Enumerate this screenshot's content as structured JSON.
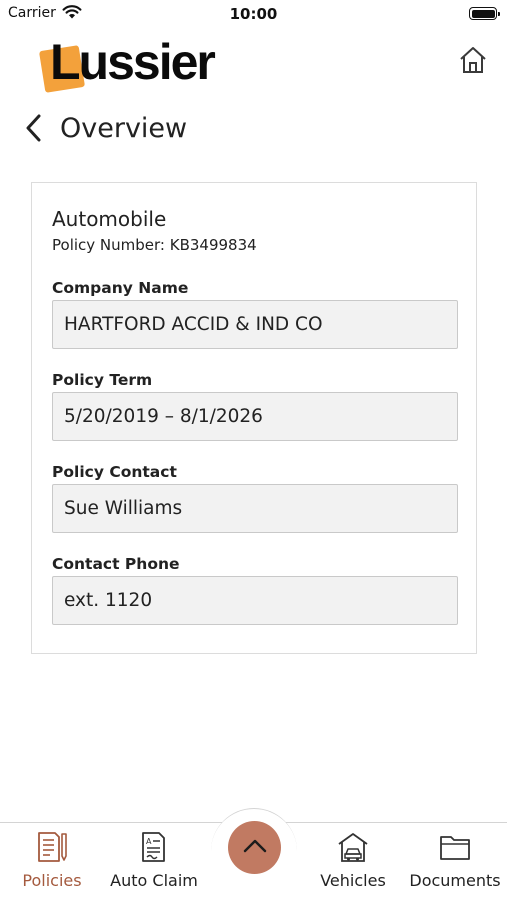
{
  "status_bar": {
    "carrier": "Carrier",
    "time": "10:00",
    "wifi_icon": "wifi-icon",
    "battery_icon": "battery-icon"
  },
  "header": {
    "logo_text": "Lussier",
    "logo_accent_color": "#f3a13b",
    "home_icon": "home-icon"
  },
  "page": {
    "back_icon": "chevron-left-icon",
    "title": "Overview"
  },
  "policy": {
    "type": "Automobile",
    "number_line": "Policy Number: KB3499834",
    "fields": [
      {
        "label": "Company Name",
        "value": "HARTFORD ACCID & IND CO"
      },
      {
        "label": "Policy Term",
        "value": "5/20/2019 – 8/1/2026"
      },
      {
        "label": "Policy Contact",
        "value": "Sue Williams"
      },
      {
        "label": "Contact Phone",
        "value": "ext. 1120"
      }
    ]
  },
  "tab_bar": {
    "accent_color": "#a45a3e",
    "fab_color": "#c17a62",
    "fab_icon": "chevron-up-icon",
    "tabs": [
      {
        "label": "Policies",
        "icon": "policy-document-icon",
        "active": true
      },
      {
        "label": "Auto Claim",
        "icon": "claim-form-icon",
        "active": false
      },
      {
        "label": "Vehicles",
        "icon": "garage-car-icon",
        "active": false
      },
      {
        "label": "Documents",
        "icon": "folder-icon",
        "active": false
      }
    ]
  }
}
